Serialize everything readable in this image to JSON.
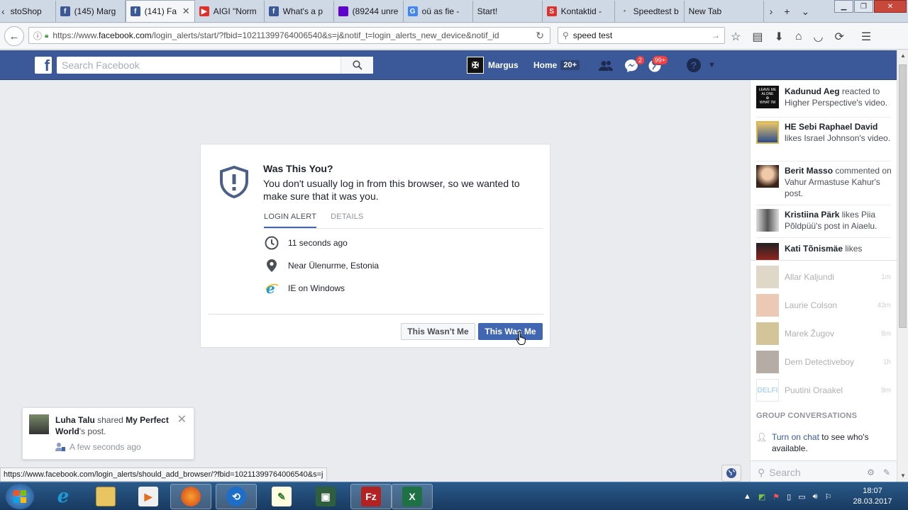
{
  "browser": {
    "tabs": [
      {
        "label": "stoShop",
        "icon": "shop-icon",
        "color": "#888888"
      },
      {
        "label": "(145) Marg",
        "icon": "facebook-icon",
        "color": "#3b5998"
      },
      {
        "label": "(141) Fa",
        "icon": "facebook-icon",
        "color": "#3b5998",
        "active": true
      },
      {
        "label": "AIGI \"Norm",
        "icon": "youtube-icon",
        "color": "#e52d27"
      },
      {
        "label": "What's a p",
        "icon": "facebook-icon",
        "color": "#3b5998"
      },
      {
        "label": "(89244 unre",
        "icon": "yahoo-mail-icon",
        "color": "#6001d2"
      },
      {
        "label": "oü as fie -",
        "icon": "google-icon",
        "color": "#4285f4"
      },
      {
        "label": "Start!",
        "icon": "blank-icon",
        "color": "#ffffff"
      },
      {
        "label": "Kontaktid -",
        "icon": "kontaktid-icon",
        "color": "#e0312c"
      },
      {
        "label": "Speedtest b",
        "icon": "speedtest-icon",
        "color": "#555555"
      },
      {
        "label": "New Tab",
        "icon": "blank-icon",
        "color": "#ffffff"
      }
    ],
    "url_prefix": "https://www.",
    "url_domain": "facebook.com",
    "url_rest": "/login_alerts/start/?fbid=10211399764006540&s=j&notif_t=login_alerts_new_device&notif_id",
    "search_value": "speed test",
    "status_url": "https://www.facebook.com/login_alerts/should_add_browser/?fbid=10211399764006540&s=j"
  },
  "fb": {
    "search_placeholder": "Search Facebook",
    "user_name": "Margus",
    "home_label": "Home",
    "home_count": "20+",
    "messages_badge": "2",
    "notifications_badge": "99+",
    "brand_color": "#3b5998"
  },
  "alert": {
    "title": "Was This You?",
    "description": "You don't usually log in from this browser, so we wanted to make sure that it was you.",
    "tab_login_alert": "LOGIN ALERT",
    "tab_details": "DETAILS",
    "time": "11 seconds ago",
    "location": "Near Ülenurme, Estonia",
    "browser": "IE on Windows",
    "btn_wasnt": "This Wasn't Me",
    "btn_was": "This Was Me"
  },
  "sidebar": {
    "notifications": [
      {
        "name": "Kadunud Aeg",
        "action": " reacted to Higher Perspective's video."
      },
      {
        "name": "HE Sebi Raphael David",
        "action": " likes Israel Johnson's video."
      },
      {
        "name": "Berit Masso",
        "action": " commented on Vahur Armastuse Kahur's post."
      },
      {
        "name": "Kristiina Pärk",
        "action": " likes Piia Põldpüü's post in Aiaelu."
      },
      {
        "name": "Kati Tõnismäe",
        "action": " likes"
      }
    ],
    "contacts": [
      {
        "name": "Allar Kaljundi",
        "time": "1m"
      },
      {
        "name": "Laurie Colson",
        "time": "43m"
      },
      {
        "name": "Marek Žugov",
        "time": "8m"
      },
      {
        "name": "Dem Detectiveboy",
        "time": "1h"
      },
      {
        "name": "Puutini Oraakel",
        "time": "9m"
      }
    ],
    "group_header": "GROUP CONVERSATIONS",
    "turn_on_link": "Turn on chat",
    "turn_on_rest": " to see who's available.",
    "chat_search_placeholder": "Search"
  },
  "toast": {
    "name": "Luha Talu",
    "mid": " shared ",
    "target": "My Perfect World",
    "end": "'s post.",
    "time": "A few seconds ago"
  },
  "taskbar": {
    "time": "18:07",
    "date": "28.03.2017"
  }
}
